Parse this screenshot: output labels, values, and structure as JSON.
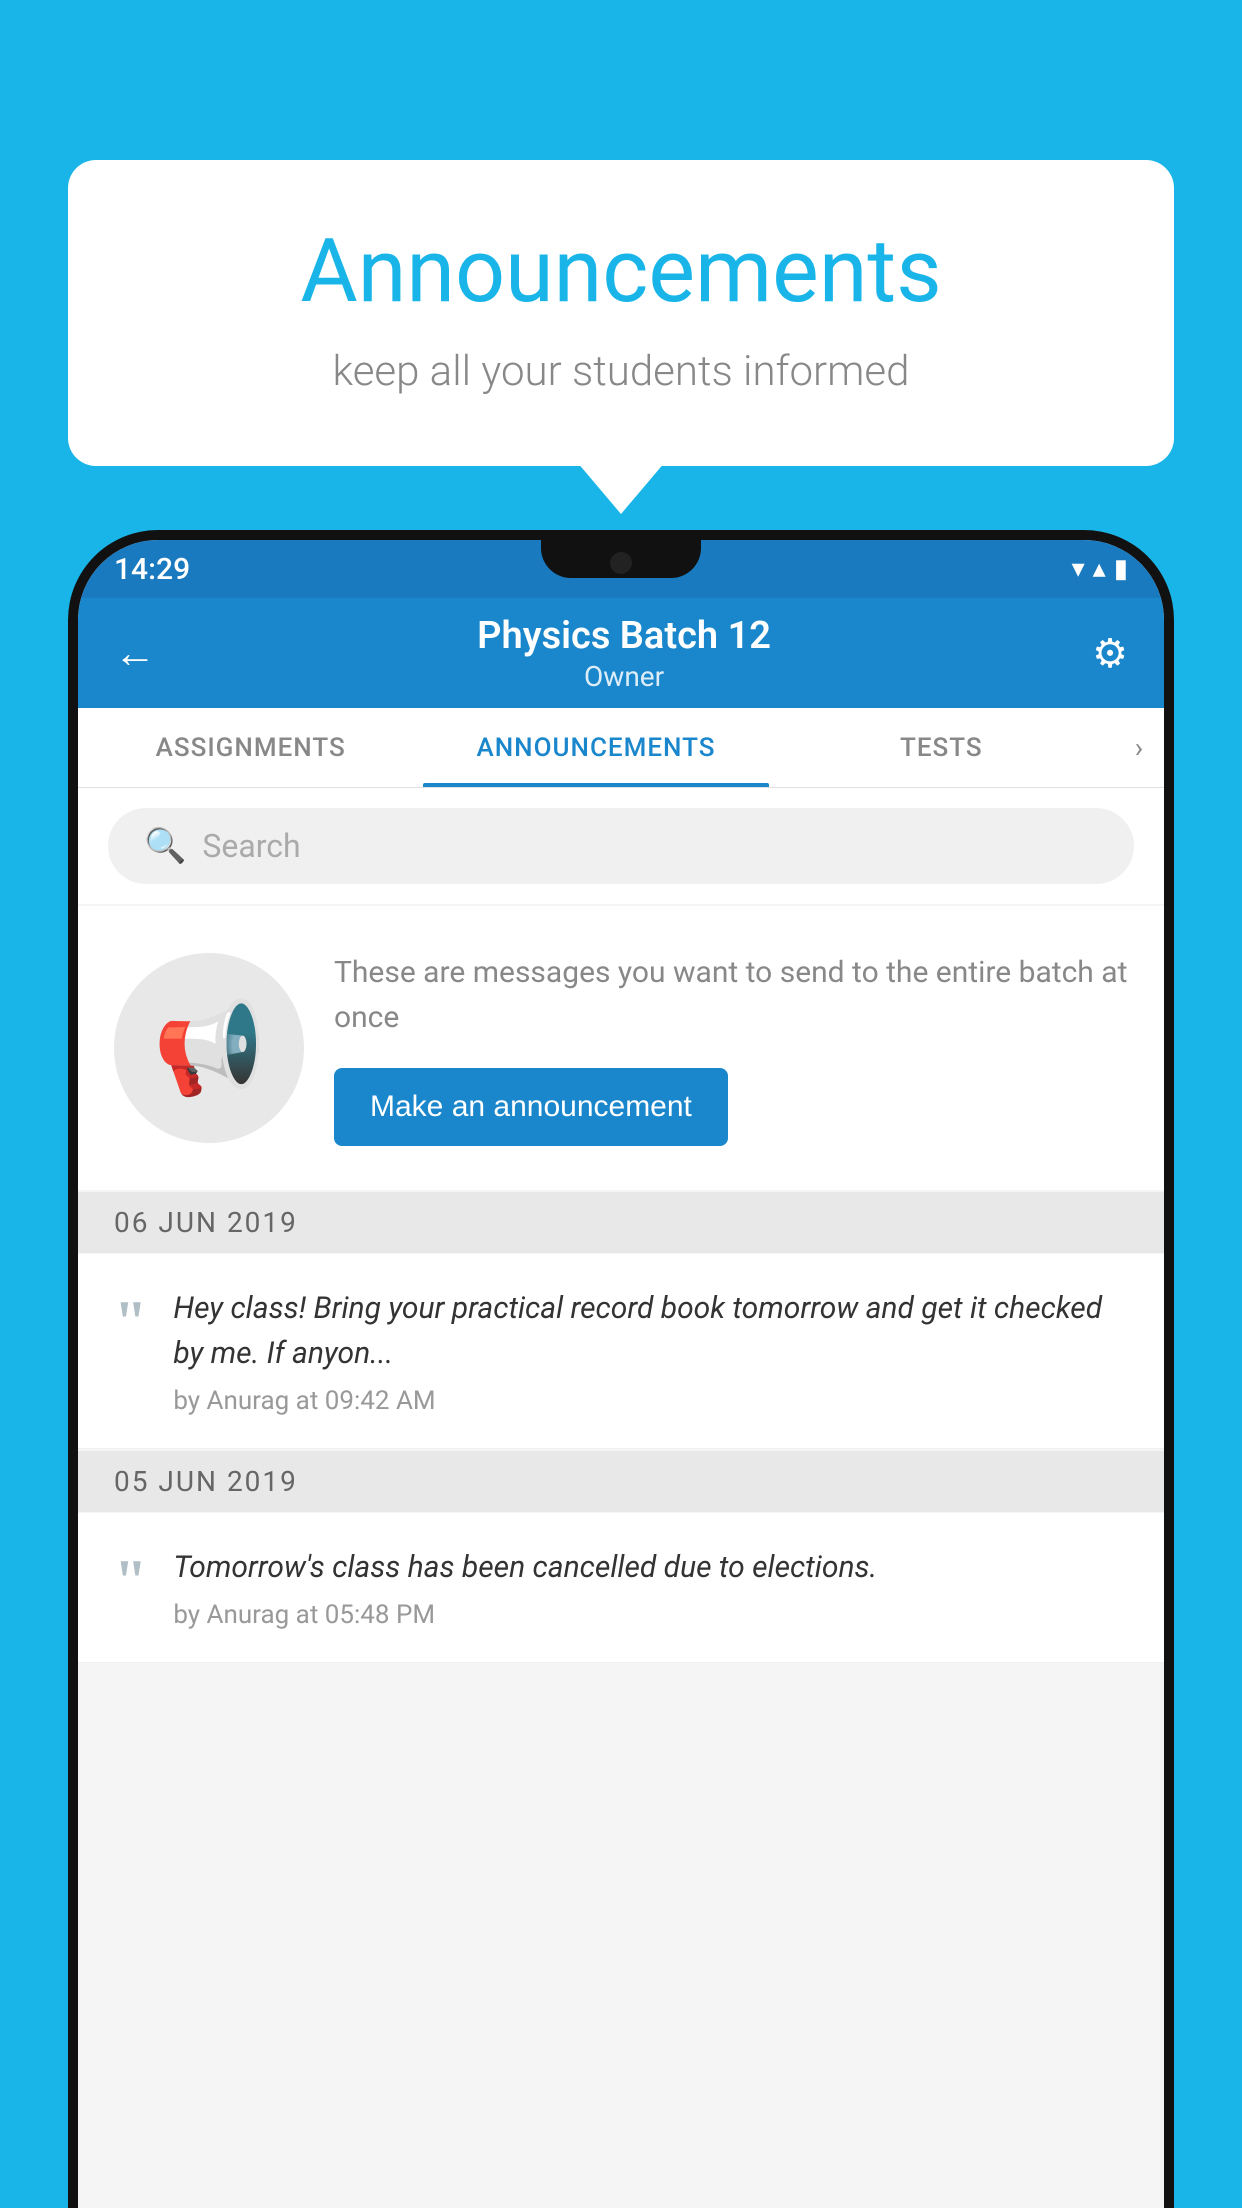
{
  "bubble": {
    "title": "Announcements",
    "subtitle": "keep all your students informed"
  },
  "status_bar": {
    "time": "14:29",
    "wifi": "▼",
    "signal": "▲",
    "battery": "▮"
  },
  "header": {
    "back_label": "←",
    "title": "Physics Batch 12",
    "subtitle": "Owner",
    "settings_label": "⚙"
  },
  "tabs": [
    {
      "label": "ASSIGNMENTS",
      "active": false
    },
    {
      "label": "ANNOUNCEMENTS",
      "active": true
    },
    {
      "label": "TESTS",
      "active": false
    }
  ],
  "search": {
    "placeholder": "Search"
  },
  "empty_state": {
    "description": "These are messages you want to send to the entire batch at once",
    "cta_label": "Make an announcement"
  },
  "announcements": [
    {
      "date": "06  JUN  2019",
      "text": "Hey class! Bring your practical record book tomorrow and get it checked by me. If anyon...",
      "meta": "by Anurag at 09:42 AM"
    },
    {
      "date": "05  JUN  2019",
      "text": "Tomorrow's class has been cancelled due to elections.",
      "meta": "by Anurag at 05:48 PM"
    }
  ],
  "colors": {
    "brand_blue": "#1a87cc",
    "sky_blue": "#1ab5e8",
    "header_blue": "#1a7abf"
  }
}
